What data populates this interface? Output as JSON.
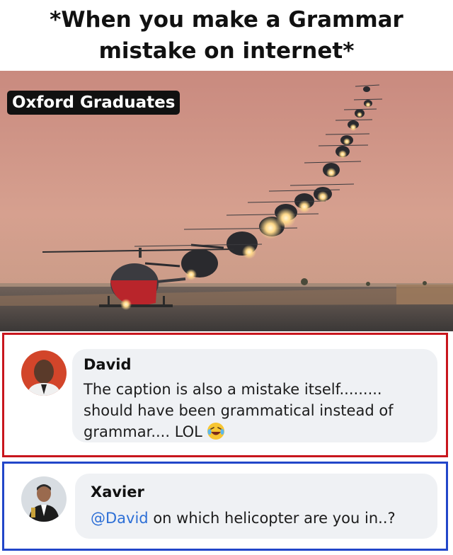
{
  "meme": {
    "title_line1": "*When you make a Grammar",
    "title_line2": "mistake on internet*",
    "image_label": "Oxford Graduates"
  },
  "comments": [
    {
      "author": "David",
      "text_line1": "The caption is also a mistake itself.........",
      "text_line2": "should have been grammatical instead of",
      "text_line3": "grammar.... LOL",
      "emoji": "laughing-crying-emoji",
      "highlight_color": "#c8161d"
    },
    {
      "author": "Xavier",
      "mention": "@David",
      "text": "on which helicopter are you in..?",
      "mention_color": "#2d6fd6",
      "highlight_color": "#2246c9"
    }
  ],
  "colors": {
    "sky_top": "#d59a8a",
    "sky_bottom": "#c89680",
    "runway": "#4c4c4c"
  }
}
